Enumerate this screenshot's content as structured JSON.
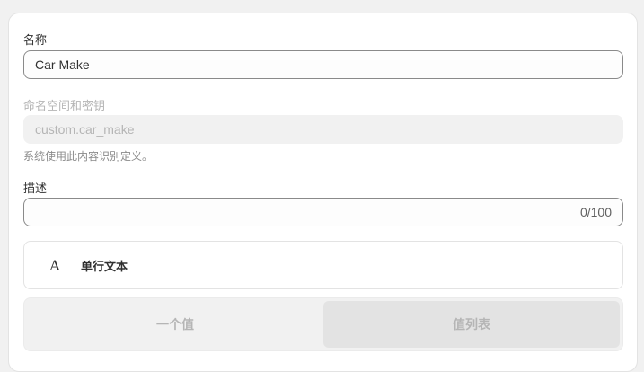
{
  "name": {
    "label": "名称",
    "value": "Car Make"
  },
  "namespace": {
    "label": "命名空间和密钥",
    "value": "custom.car_make",
    "help": "系统使用此内容识别定义。"
  },
  "description": {
    "label": "描述",
    "counter": "0/100"
  },
  "type": {
    "icon": "A",
    "label": "单行文本"
  },
  "value_mode": {
    "options": [
      "一个值",
      "值列表"
    ]
  }
}
